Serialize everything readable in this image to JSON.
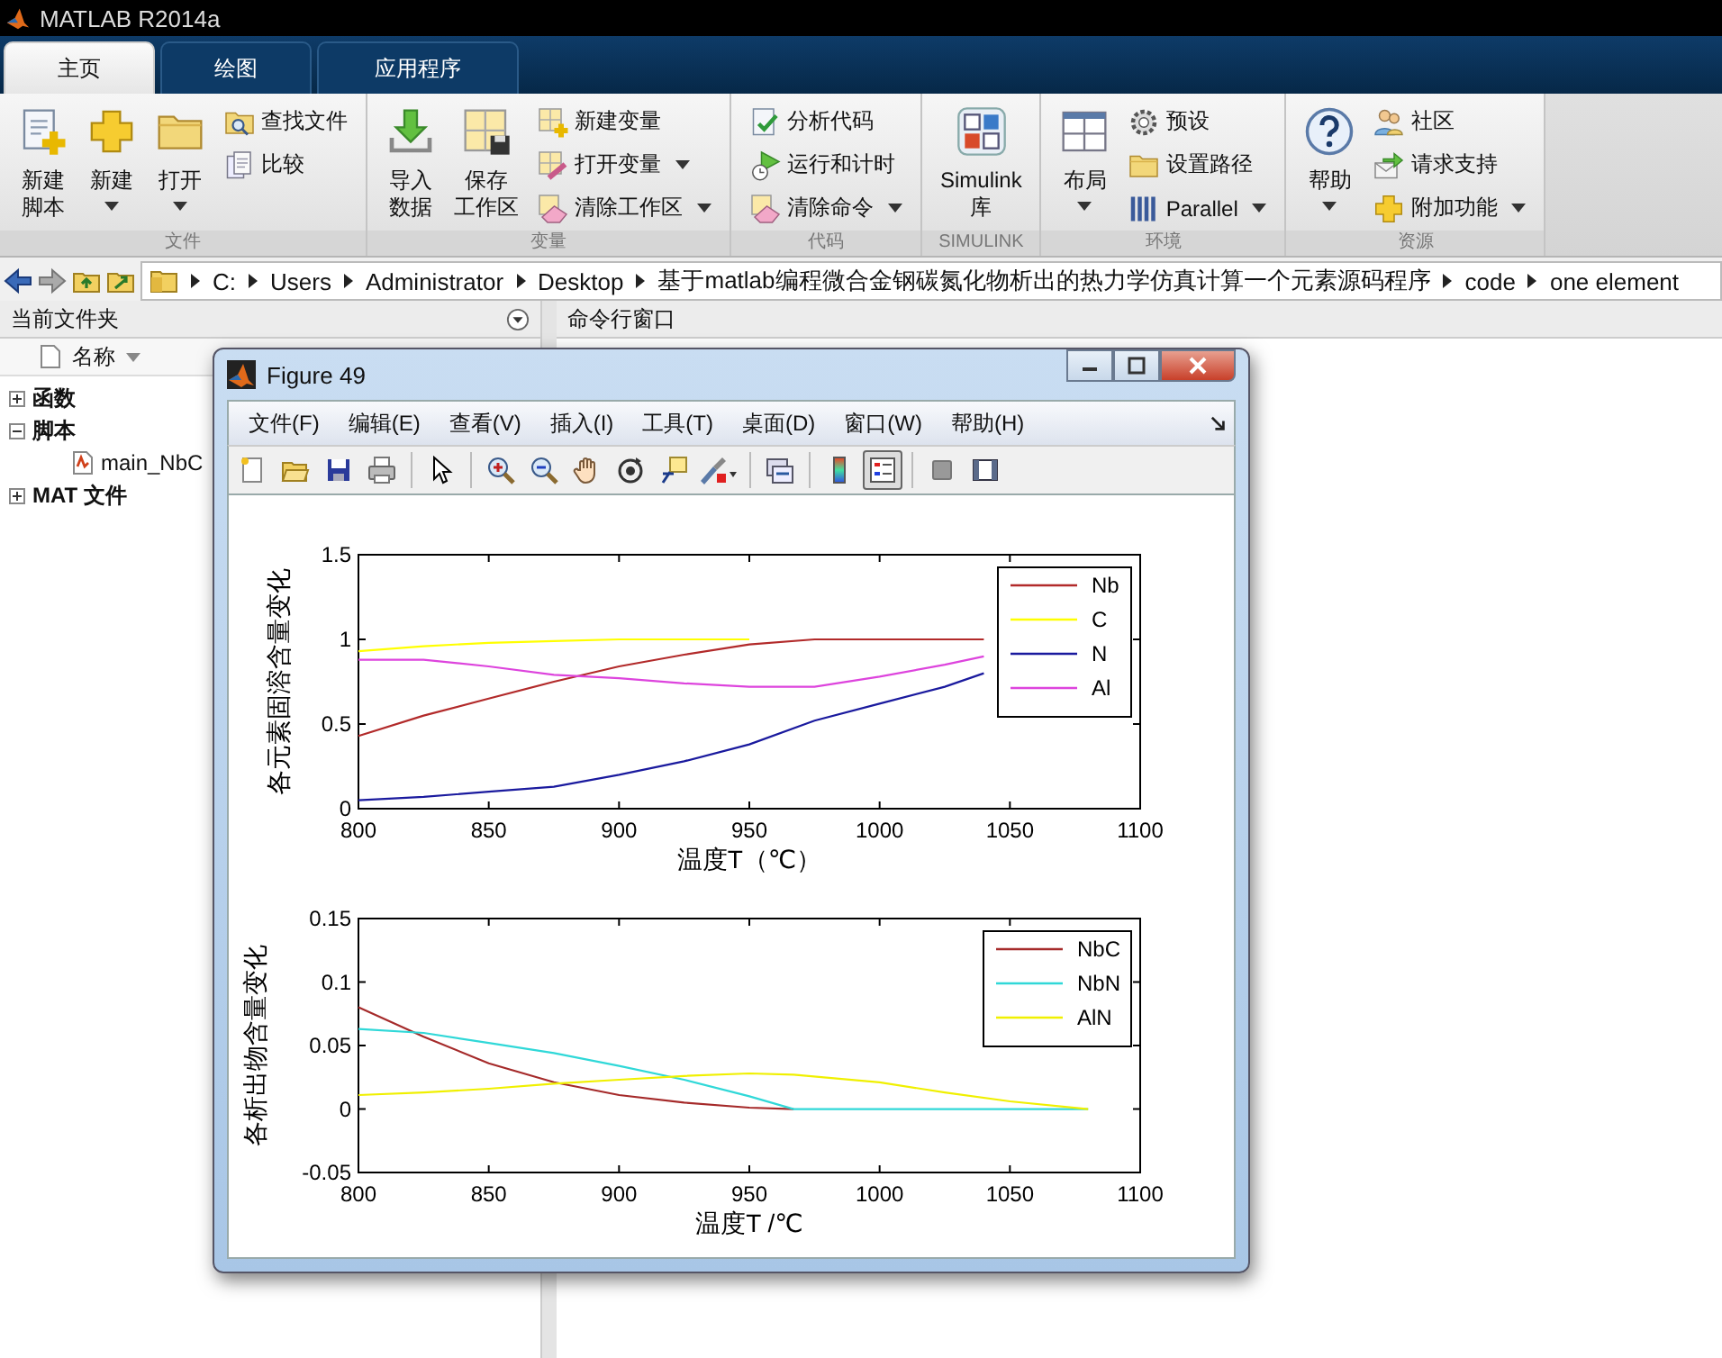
{
  "window": {
    "title": "MATLAB R2014a"
  },
  "tabs": [
    {
      "label": "主页",
      "selected": true
    },
    {
      "label": "绘图",
      "selected": false
    },
    {
      "label": "应用程序",
      "selected": false
    }
  ],
  "ribbon": {
    "groups": [
      {
        "label": "文件",
        "large": [
          {
            "lines": [
              "新建",
              "脚本"
            ],
            "dropdown": false
          },
          {
            "lines": [
              "新建"
            ],
            "dropdown": true
          },
          {
            "lines": [
              "打开"
            ],
            "dropdown": true
          }
        ],
        "small": [
          {
            "label": "查找文件",
            "dropdown": false
          },
          {
            "label": "比较",
            "dropdown": false
          }
        ]
      },
      {
        "label": "变量",
        "large": [
          {
            "lines": [
              "导入",
              "数据"
            ],
            "dropdown": false
          },
          {
            "lines": [
              "保存",
              "工作区"
            ],
            "dropdown": false
          }
        ],
        "small": [
          {
            "label": "新建变量",
            "dropdown": false
          },
          {
            "label": "打开变量",
            "dropdown": true
          },
          {
            "label": "清除工作区",
            "dropdown": true
          }
        ]
      },
      {
        "label": "代码",
        "small": [
          {
            "label": "分析代码",
            "dropdown": false
          },
          {
            "label": "运行和计时",
            "dropdown": false
          },
          {
            "label": "清除命令",
            "dropdown": true
          }
        ]
      },
      {
        "label": "SIMULINK",
        "large": [
          {
            "lines": [
              "Simulink",
              "库"
            ],
            "dropdown": false
          }
        ]
      },
      {
        "label": "环境",
        "large": [
          {
            "lines": [
              "布局"
            ],
            "dropdown": true
          }
        ],
        "small": [
          {
            "label": "预设",
            "dropdown": false
          },
          {
            "label": "设置路径",
            "dropdown": false
          },
          {
            "label": "Parallel",
            "dropdown": true
          }
        ]
      },
      {
        "label": "资源",
        "large": [
          {
            "lines": [
              "帮助"
            ],
            "dropdown": true
          }
        ],
        "small": [
          {
            "label": "社区",
            "dropdown": false
          },
          {
            "label": "请求支持",
            "dropdown": false
          },
          {
            "label": "附加功能",
            "dropdown": true
          }
        ]
      }
    ]
  },
  "address_bar": {
    "path": [
      "C:",
      "Users",
      "Administrator",
      "Desktop",
      "基于matlab编程微合金钢碳氮化物析出的热力学仿真计算一个元素源码程序",
      "code",
      "one element"
    ]
  },
  "current_folder": {
    "title": "当前文件夹",
    "column": "名称",
    "items": [
      {
        "label": "函数",
        "expanded": false
      },
      {
        "label": "脚本",
        "expanded": true,
        "children": [
          {
            "label": "main_NbC"
          }
        ]
      },
      {
        "label": "MAT 文件",
        "expanded": false
      }
    ]
  },
  "command_window": {
    "title": "命令行窗口"
  },
  "figure": {
    "title": "Figure 49",
    "menus": [
      "文件(F)",
      "编辑(E)",
      "查看(V)",
      "插入(I)",
      "工具(T)",
      "桌面(D)",
      "窗口(W)",
      "帮助(H)"
    ],
    "toolbar": [
      {
        "pressed": false
      },
      {
        "pressed": false
      },
      {
        "pressed": false
      },
      {
        "pressed": false
      },
      {
        "pressed": false
      },
      {
        "pressed": false
      },
      {
        "pressed": false
      },
      {
        "pressed": false
      },
      {
        "pressed": false
      },
      {
        "pressed": false
      },
      {
        "pressed": false
      },
      {
        "pressed": false
      },
      {
        "pressed": false
      },
      {
        "pressed": true
      },
      {
        "pressed": false
      },
      {
        "pressed": false
      }
    ],
    "plots": [
      {
        "chart_data": {
          "type": "line",
          "xlabel": "温度T（℃）",
          "ylabel": "各元素固溶含量变化",
          "x": [
            800,
            825,
            850,
            875,
            900,
            925,
            950,
            975,
            1000,
            1025,
            1040
          ],
          "series": [
            {
              "name": "Nb",
              "color": "#b22a2a",
              "values": [
                0.43,
                0.55,
                0.65,
                0.75,
                0.84,
                0.91,
                0.97,
                1.0,
                1.0,
                1.0,
                1.0
              ]
            },
            {
              "name": "C",
              "color": "#ffff00",
              "values": [
                0.93,
                0.96,
                0.98,
                0.99,
                1.0,
                1.0,
                1.0,
                null,
                null,
                null,
                null
              ]
            },
            {
              "name": "N",
              "color": "#1a1a9e",
              "values": [
                0.05,
                0.07,
                0.1,
                0.13,
                0.2,
                0.28,
                0.38,
                0.52,
                0.62,
                0.72,
                0.8
              ]
            },
            {
              "name": "Al",
              "color": "#dd44dd",
              "values": [
                0.88,
                0.88,
                0.84,
                0.79,
                0.77,
                0.74,
                0.72,
                0.72,
                0.78,
                0.85,
                0.9
              ]
            }
          ],
          "legend": "upper right",
          "xlim": [
            800,
            1100
          ],
          "ylim": [
            0,
            1.5
          ],
          "xticks": [
            800,
            850,
            900,
            950,
            1000,
            1050,
            1100
          ],
          "yticks": [
            0,
            0.5,
            1,
            1.5
          ]
        }
      },
      {
        "chart_data": {
          "type": "line",
          "xlabel": "温度T /℃",
          "ylabel": "各析出物含量变化",
          "x": [
            800,
            825,
            850,
            875,
            900,
            925,
            950,
            967,
            1000,
            1025,
            1050,
            1080
          ],
          "series": [
            {
              "name": "NbC",
              "color": "#a52a2a",
              "values": [
                0.08,
                0.057,
                0.036,
                0.021,
                0.011,
                0.005,
                0.001,
                0,
                null,
                null,
                null,
                null
              ]
            },
            {
              "name": "NbN",
              "color": "#30d8d8",
              "values": [
                0.063,
                0.06,
                0.052,
                0.044,
                0.034,
                0.023,
                0.01,
                0,
                0,
                0,
                0,
                0
              ]
            },
            {
              "name": "AlN",
              "color": "#f0f000",
              "values": [
                0.011,
                0.013,
                0.016,
                0.02,
                0.023,
                0.026,
                0.028,
                0.027,
                0.021,
                0.013,
                0.006,
                0
              ]
            }
          ],
          "legend": "upper right",
          "xlim": [
            800,
            1100
          ],
          "ylim": [
            -0.05,
            0.15
          ],
          "xticks": [
            800,
            850,
            900,
            950,
            1000,
            1050,
            1100
          ],
          "yticks": [
            -0.05,
            0,
            0.05,
            0.1,
            0.15
          ]
        }
      }
    ]
  }
}
